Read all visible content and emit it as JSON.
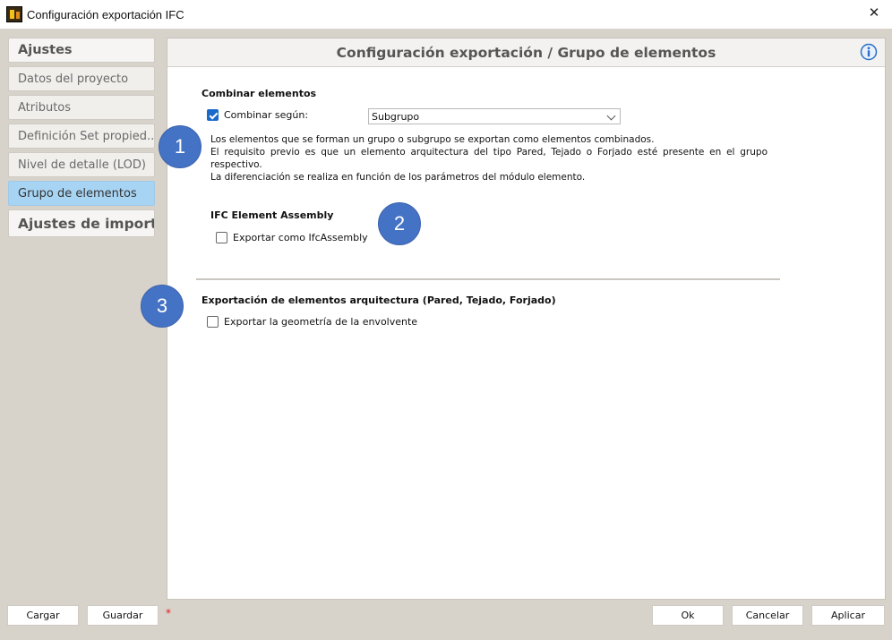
{
  "window": {
    "title": "Configuración exportación IFC",
    "close_glyph": "✕",
    "app_icon": "allplan-app-icon"
  },
  "sidebar": {
    "items": [
      {
        "label": "Ajustes",
        "kind": "header"
      },
      {
        "label": "Datos del proyecto",
        "kind": "item"
      },
      {
        "label": "Atributos",
        "kind": "item"
      },
      {
        "label": "Definición Set propied...",
        "kind": "item"
      },
      {
        "label": "Nivel de detalle (LOD)",
        "kind": "item"
      },
      {
        "label": "Grupo de elementos",
        "kind": "item",
        "selected": true
      },
      {
        "label": "Ajustes de import...",
        "kind": "section"
      }
    ]
  },
  "panel": {
    "title": "Configuración exportación / Grupo de elementos",
    "info_icon": "info-icon",
    "combine": {
      "title": "Combinar elementos",
      "checkbox_label": "Combinar según:",
      "checked": true,
      "dropdown_value": "Subgrupo",
      "description_lines": [
        "Los elementos que se forman un grupo o subgrupo se exportan como  elementos combinados.",
        "El requisito previo es que un elemento arquitectura del tipo Pared,  Tejado o Forjado esté presente en el grupo respectivo.",
        "La diferenciación se realiza en función de los parámetros  del módulo elemento."
      ]
    },
    "assembly": {
      "title": "IFC Element Assembly",
      "checkbox_label": "Exportar como IfcAssembly",
      "checked": false
    },
    "architecture": {
      "title": "Exportación de elementos arquitectura (Pared, Tejado, Forjado)",
      "checkbox_label": "Exportar la geometría de la envolvente",
      "checked": false
    }
  },
  "markers": [
    "1",
    "2",
    "3"
  ],
  "footer": {
    "load_label": "Cargar",
    "save_label": "Guardar",
    "modified_indicator": "*",
    "ok_label": "Ok",
    "cancel_label": "Cancelar",
    "apply_label": "Aplicar"
  },
  "colors": {
    "selected_nav": "#a8d4f4",
    "marker_blue": "#4472c4",
    "checkbox_blue": "#1b6ac9",
    "client_bg": "#d7d2ca"
  }
}
